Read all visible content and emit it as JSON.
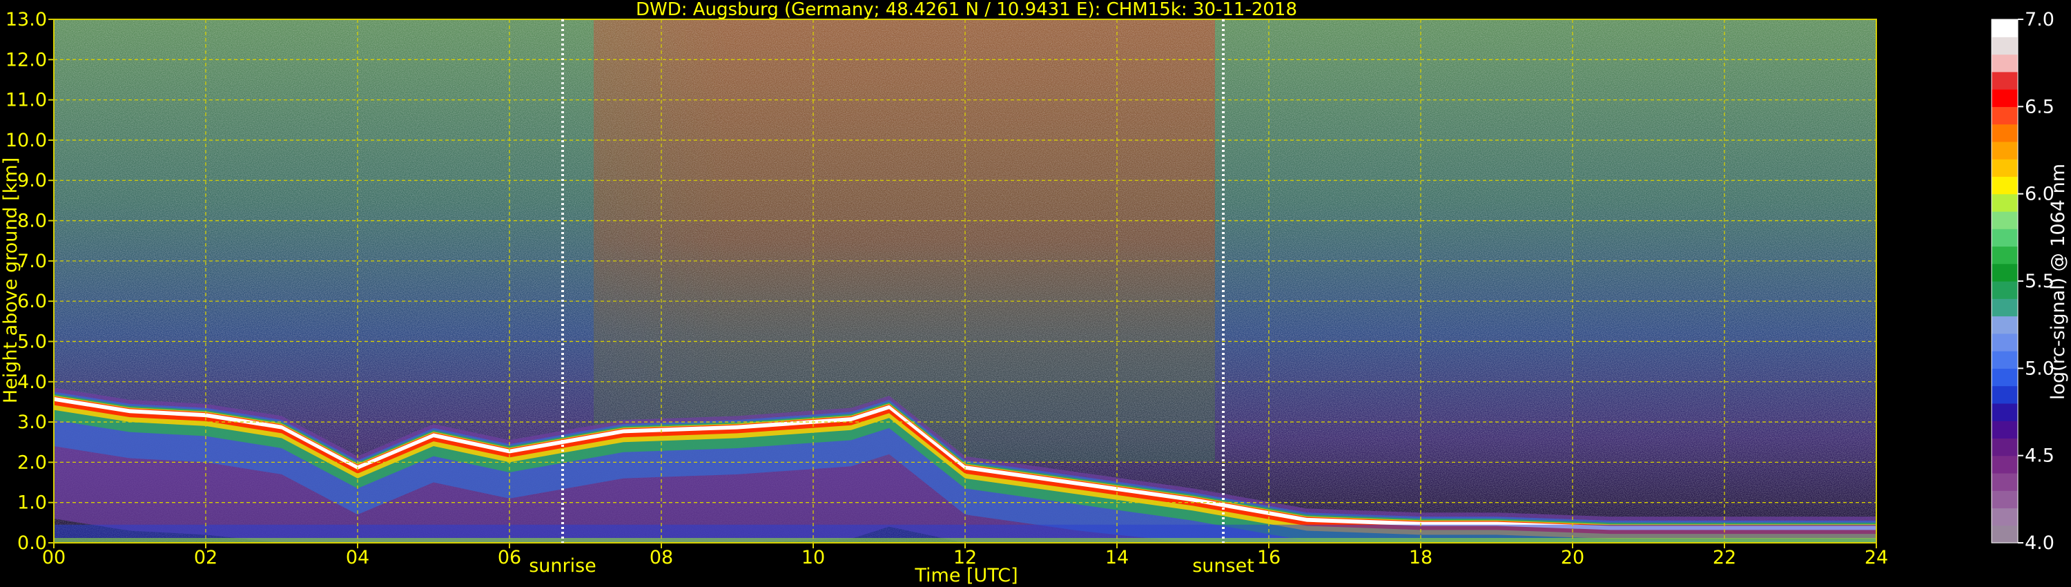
{
  "chart_data": {
    "type": "heatmap",
    "title": "DWD: Augsburg (Germany; 48.4261 N / 10.9431 E):    CHM15k: 30-11-2018",
    "xlabel": "Time [UTC]",
    "ylabel": "Height above ground [km]",
    "xlim": [
      0,
      24
    ],
    "ylim": [
      0,
      13
    ],
    "x_ticks": [
      "00",
      "02",
      "04",
      "06",
      "08",
      "10",
      "12",
      "14",
      "16",
      "18",
      "20",
      "22",
      "24"
    ],
    "y_ticks": [
      "0.0",
      "1.0",
      "2.0",
      "3.0",
      "4.0",
      "5.0",
      "6.0",
      "7.0",
      "8.0",
      "9.0",
      "10.0",
      "11.0",
      "12.0",
      "13.0"
    ],
    "grid": true,
    "markers": [
      {
        "label": "sunrise",
        "x": 6.7
      },
      {
        "label": "sunset",
        "x": 15.4
      }
    ],
    "colorbar": {
      "label": "log(rc-signal) @ 1064 nm",
      "range": [
        4.0,
        7.0
      ],
      "ticks": [
        "4.0",
        "4.5",
        "5.0",
        "5.5",
        "6.0",
        "6.5",
        "7.0"
      ],
      "colors": [
        "#9a879e",
        "#a07ea8",
        "#955f9d",
        "#8a4592",
        "#7a2b88",
        "#651c86",
        "#4a0f93",
        "#2a16a8",
        "#1f3cd0",
        "#2f5ee8",
        "#4a78ee",
        "#6d90ec",
        "#86a3e4",
        "#3aa48a",
        "#23a05a",
        "#119a2c",
        "#2bb446",
        "#55cf74",
        "#84e07f",
        "#b7ee3c",
        "#fff000",
        "#ffc400",
        "#ffa200",
        "#ff7a00",
        "#ff4a1e",
        "#ff0000",
        "#e63030",
        "#f4b8b8",
        "#e6dddd",
        "#ffffff"
      ]
    },
    "cloud_base_km": [
      {
        "t": 0.0,
        "h": 3.6
      },
      {
        "t": 1.0,
        "h": 3.3
      },
      {
        "t": 2.0,
        "h": 3.2
      },
      {
        "t": 3.0,
        "h": 2.9
      },
      {
        "t": 4.0,
        "h": 1.9
      },
      {
        "t": 5.0,
        "h": 2.7
      },
      {
        "t": 6.0,
        "h": 2.3
      },
      {
        "t": 7.5,
        "h": 2.8
      },
      {
        "t": 9.0,
        "h": 2.9
      },
      {
        "t": 10.5,
        "h": 3.1
      },
      {
        "t": 11.0,
        "h": 3.4
      },
      {
        "t": 12.0,
        "h": 1.9
      },
      {
        "t": 13.5,
        "h": 1.5
      },
      {
        "t": 15.0,
        "h": 1.1
      },
      {
        "t": 16.5,
        "h": 0.6
      },
      {
        "t": 18.0,
        "h": 0.5
      },
      {
        "t": 19.0,
        "h": 0.5
      },
      {
        "t": 20.5,
        "h": 0.4
      },
      {
        "t": 22.0,
        "h": 0.4
      },
      {
        "t": 24.0,
        "h": 0.4
      }
    ]
  }
}
